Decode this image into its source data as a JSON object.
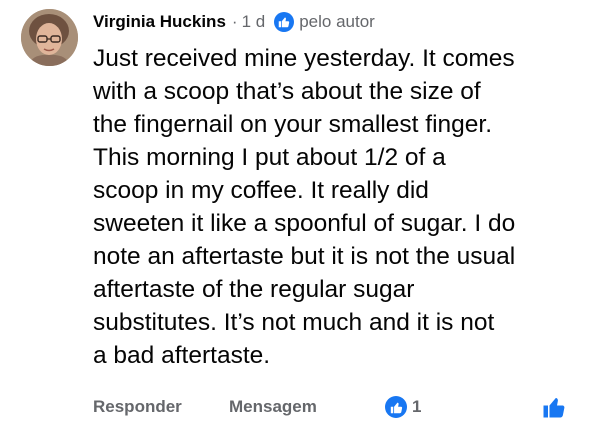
{
  "comment": {
    "author": "Virginia Huckins",
    "separator": "·",
    "time": "1 d",
    "liked_by_label": "pelo autor",
    "text": "Just received mine yesterday.  It comes\nwith a scoop that’s about the size of\nthe fingernail on your smallest finger.\nThis morning I put about 1/2 of a\nscoop in my coffee. It really did\nsweeten it like a spoonful of sugar. I do\nnote an aftertaste but it is not the usual\naftertaste of the regular sugar\nsubstitutes.  It’s not much and it is not\na bad aftertaste."
  },
  "actions": {
    "reply_label": "Responder",
    "message_label": "Mensagem",
    "reaction_count": "1",
    "like_icon": "thumbs-up-icon"
  },
  "colors": {
    "accent": "#1877f2",
    "secondary_text": "#65676b",
    "primary_text": "#050505"
  }
}
